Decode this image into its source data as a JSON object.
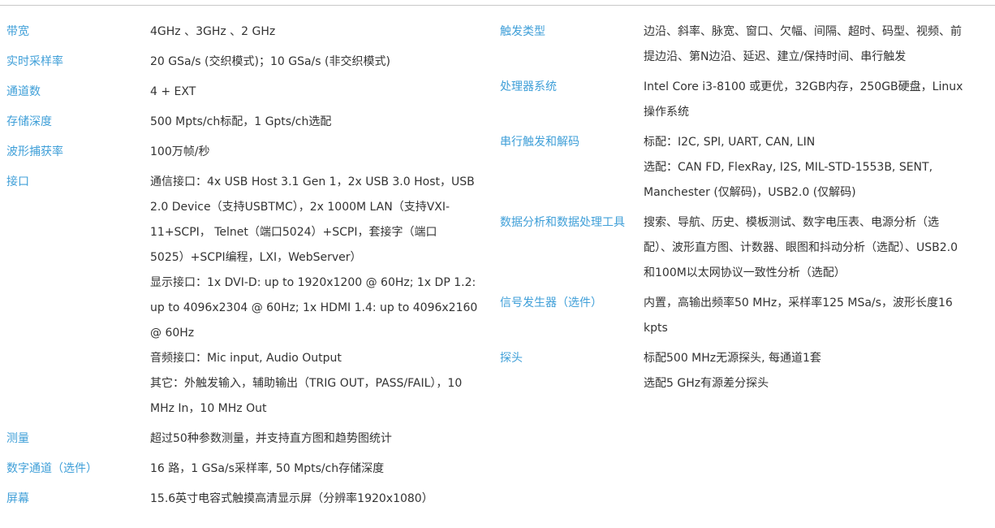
{
  "left": [
    {
      "label": "带宽",
      "lines": [
        "4GHz 、3GHz 、2 GHz"
      ]
    },
    {
      "label": "实时采样率",
      "lines": [
        "20 GSa/s (交织模式)；10 GSa/s (非交织模式)"
      ]
    },
    {
      "label": "通道数",
      "lines": [
        "4 + EXT"
      ]
    },
    {
      "label": "存储深度",
      "lines": [
        "500 Mpts/ch标配，1 Gpts/ch选配"
      ]
    },
    {
      "label": "波形捕获率",
      "lines": [
        "100万帧/秒"
      ]
    },
    {
      "label": "接口",
      "lines": [
        "通信接口：4x USB Host 3.1 Gen 1，2x USB 3.0 Host，USB 2.0 Device（支持USBTMC），2x 1000M LAN（支持VXI-11+SCPI， Telnet（端口5024）+SCPI，套接字（端口5025）+SCPI编程，LXI，WebServer）",
        "显示接口：1x DVI-D: up to 1920x1200 @ 60Hz; 1x DP 1.2: up to 4096x2304 @ 60Hz; 1x HDMI 1.4: up to 4096x2160 @ 60Hz",
        "音频接口：Mic input, Audio Output",
        "其它：外触发输入，辅助输出（TRIG OUT，PASS/FAIL），10 MHz In，10 MHz Out"
      ]
    },
    {
      "label": "测量",
      "lines": [
        "超过50种参数测量，并支持直方图和趋势图统计"
      ]
    },
    {
      "label": "数字通道（选件）",
      "lines": [
        "16 路，1 GSa/s采样率, 50 Mpts/ch存储深度"
      ]
    },
    {
      "label": "屏幕",
      "lines": [
        "15.6英寸电容式触摸高清显示屏（分辨率1920x1080）"
      ]
    }
  ],
  "right": [
    {
      "label": "触发类型",
      "lines": [
        "边沿、斜率、脉宽、窗口、欠幅、间隔、超时、码型、视频、前提边沿、第N边沿、延迟、建立/保持时间、串行触发"
      ]
    },
    {
      "label": "处理器系统",
      "lines": [
        "Intel Core i3-8100 或更优，32GB内存，250GB硬盘，Linux操作系统"
      ]
    },
    {
      "label": "串行触发和解码",
      "lines": [
        "标配：I2C, SPI, UART, CAN, LIN",
        "选配：CAN FD, FlexRay, I2S, MIL-STD-1553B, SENT, Manchester (仅解码)，USB2.0 (仅解码)"
      ]
    },
    {
      "label": "数据分析和数据处理工具",
      "lines": [
        "搜索、导航、历史、模板测试、数字电压表、电源分析（选配）、波形直方图、计数器、眼图和抖动分析（选配）、USB2.0和100M以太网协议一致性分析（选配）"
      ]
    },
    {
      "label": "信号发生器（选件）",
      "lines": [
        "内置，高输出频率50 MHz，采样率125 MSa/s，波形长度16 kpts"
      ]
    },
    {
      "label": "探头",
      "lines": [
        "标配500 MHz无源探头, 每通道1套",
        "选配5 GHz有源差分探头"
      ]
    }
  ]
}
